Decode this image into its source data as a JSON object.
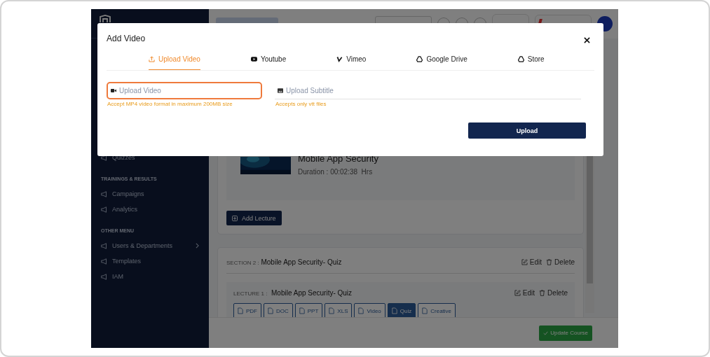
{
  "sidebar": {
    "items": [
      {
        "kind": "link",
        "label": "Quizzes"
      },
      {
        "kind": "heading",
        "label": "TRAININGS & RESULTS"
      },
      {
        "kind": "link",
        "label": "Campaigns"
      },
      {
        "kind": "link",
        "label": "Analytics"
      },
      {
        "kind": "heading",
        "label": "OTHER MENU"
      },
      {
        "kind": "submenu",
        "label": "Users & Departments"
      },
      {
        "kind": "link",
        "label": "Templates"
      },
      {
        "kind": "link",
        "label": "IAM"
      }
    ]
  },
  "course": {
    "lecture_card": {
      "title": "Mobile App Security",
      "duration": "Duration : 00:02:38  Hrs"
    },
    "add_lecture": "Add Lecture",
    "section": {
      "prefix": "SECTION 2 :",
      "title": "Mobile App Security- Quiz",
      "edit": "Edit",
      "delete": "Delete"
    },
    "lecture": {
      "prefix": "LECTURE 1 :",
      "title": "Mobile App Security- Quiz",
      "edit": "Edit",
      "delete": "Delete",
      "file_types": [
        {
          "label": "PDF",
          "selected": false
        },
        {
          "label": "DOC",
          "selected": false
        },
        {
          "label": "PPT",
          "selected": false
        },
        {
          "label": "XLS",
          "selected": false
        },
        {
          "label": "Video",
          "selected": false
        },
        {
          "label": "Quiz",
          "selected": true
        },
        {
          "label": "Creative",
          "selected": false
        }
      ]
    }
  },
  "footer": {
    "button": "Update Course"
  },
  "modal": {
    "title": "Add Video",
    "tabs": [
      {
        "label": "Upload Video",
        "selected": true
      },
      {
        "label": "Youtube",
        "selected": false
      },
      {
        "label": "Vimeo",
        "selected": false
      },
      {
        "label": "Google Drive",
        "selected": false
      },
      {
        "label": "Store",
        "selected": false
      }
    ],
    "fields": [
      {
        "kind": "video",
        "placeholder": "Upload Video",
        "hint": "Accept MP4 video format in maximum 200MB size",
        "focused": true
      },
      {
        "kind": "subtitle",
        "placeholder": "Upload Subtitle",
        "hint": "Accepts only vtt files",
        "focused": false
      }
    ],
    "button": "Upload"
  }
}
